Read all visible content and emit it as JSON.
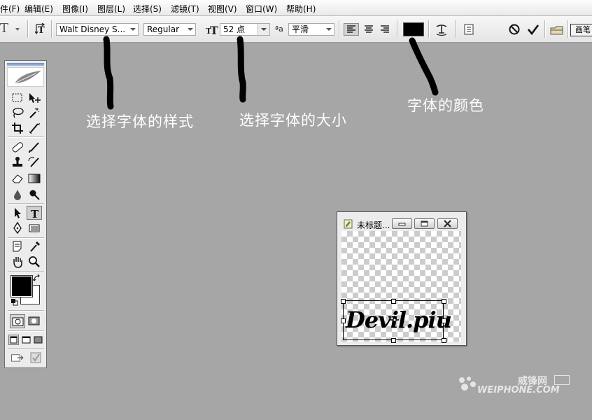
{
  "menu": [
    "件(F)",
    "编辑(E)",
    "图像(I)",
    "图层(L)",
    "选择(S)",
    "滤镜(T)",
    "视图(V)",
    "窗口(W)",
    "帮助(H)"
  ],
  "options_bar": {
    "tool_glyph": "T",
    "font_family": "Walt Disney S...",
    "font_style": "Regular",
    "font_size": "52 点",
    "anti_alias_prefix": "ªa",
    "anti_alias": "平滑",
    "text_color": "#000000",
    "palette_label": "画笔"
  },
  "annotations": {
    "font_style_label": "选择字体的样式",
    "font_size_label": "选择字体的大小",
    "font_color_label": "字体的颜色"
  },
  "colors": {
    "foreground": "#000000",
    "background": "#ffffff",
    "workspace": "#a6a6a6",
    "caption_text": "#ffffff"
  },
  "document": {
    "title": "未标题...",
    "text": "Devil.piu"
  },
  "watermark": {
    "brand_cn": "威锋网",
    "brand_en": "WEIPHONE.COM"
  }
}
